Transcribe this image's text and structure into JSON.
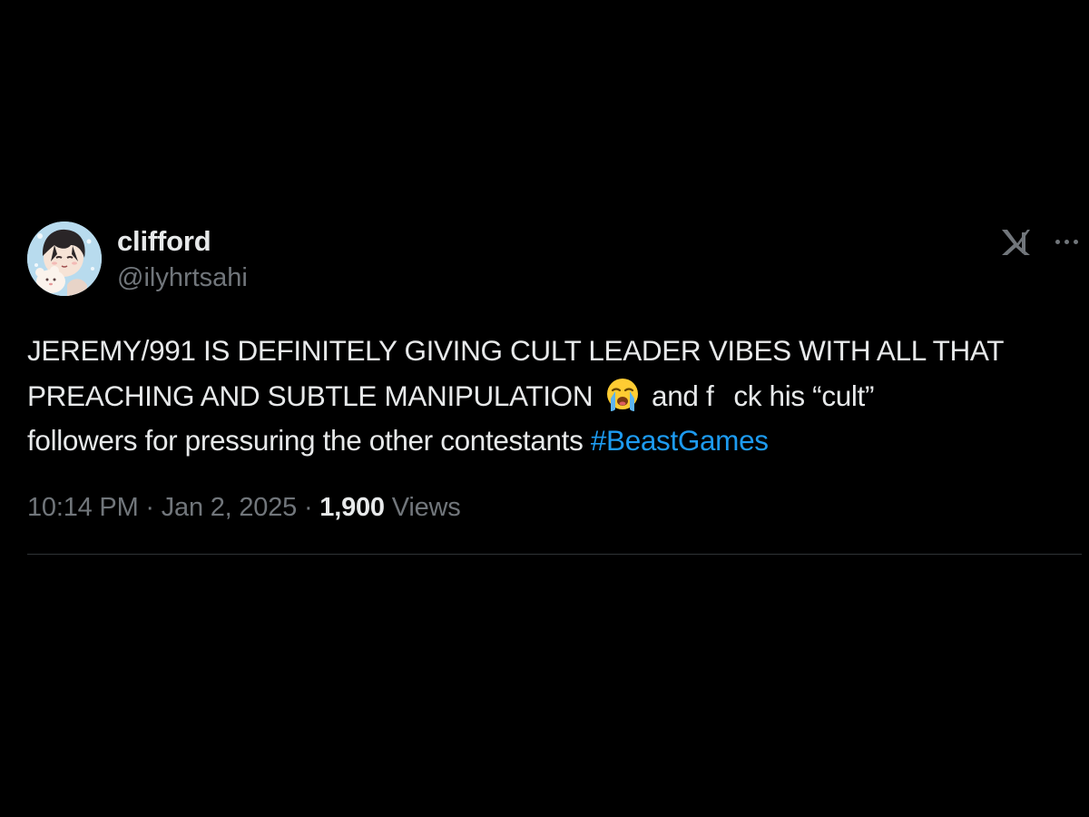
{
  "tweet": {
    "author": {
      "display_name": "clifford",
      "handle": "@ilyhrtsahi"
    },
    "body": {
      "line1": "JEREMY/991 IS DEFINITELY GIVING CULT LEADER VIBES WITH ALL THAT",
      "line2_before_emoji": "PREACHING AND SUBTLE MANIPULATION",
      "emoji": "loudly-crying-face",
      "line2_after_emoji_a": "and f",
      "line2_after_emoji_b": "ck his “cult”",
      "line3": "followers for pressuring the other contestants",
      "hashtag": "#BeastGames"
    },
    "meta": {
      "time": "10:14 PM",
      "separator": "·",
      "date": "Jan 2, 2025",
      "views_count": "1,900",
      "views_label": "Views"
    },
    "icons": {
      "brand": "x-logo-icon",
      "more": "more-options-icon"
    }
  },
  "colors": {
    "background": "#000000",
    "primary_text": "#e7e9ea",
    "secondary_text": "#71767b",
    "hashtag": "#1d9bf0",
    "divider": "#2f3336"
  }
}
